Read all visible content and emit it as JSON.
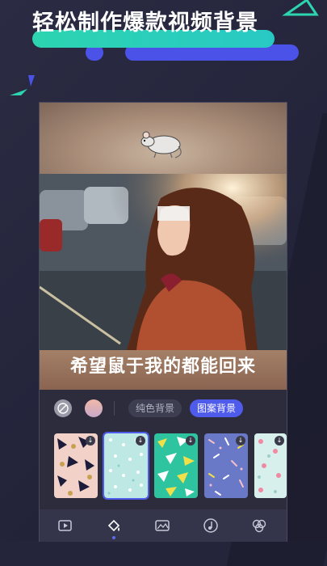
{
  "promo": {
    "headline": "轻松制作爆款视频背景",
    "colors": {
      "teal": "#2dd4b0",
      "blue": "#4a52e8",
      "background": "#24243a"
    }
  },
  "canvas": {
    "caption": "希望鼠于我的都能回来",
    "sticker_icon": "mouse-sticker"
  },
  "background_options": {
    "none_icon": "no-background-icon",
    "gradient_icon": "gradient-swatch",
    "solid_label": "纯色背景",
    "pattern_label": "图案背景",
    "active": "图案背景"
  },
  "patterns": [
    {
      "name": "leaves-pattern",
      "selected": false,
      "downloaded": true
    },
    {
      "name": "dots-pattern",
      "selected": true,
      "downloaded": false
    },
    {
      "name": "triangles-pattern",
      "selected": false,
      "downloaded": false
    },
    {
      "name": "confetti-pattern",
      "selected": false,
      "downloaded": false
    },
    {
      "name": "hearts-pattern",
      "selected": false,
      "downloaded": false
    }
  ],
  "toolbar": {
    "items": [
      "video-add-icon",
      "paint-bucket-icon",
      "image-icon",
      "music-icon",
      "filter-icon"
    ],
    "active": "paint-bucket-icon"
  }
}
